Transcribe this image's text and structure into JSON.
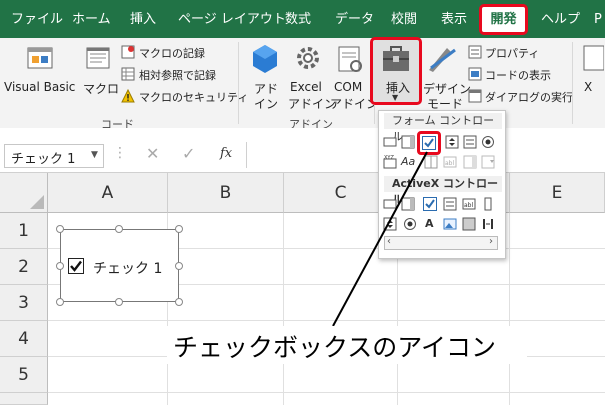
{
  "menu": {
    "tabs": [
      "ファイル",
      "ホーム",
      "挿入",
      "ページ レイアウト",
      "数式",
      "データ",
      "校閲",
      "表示"
    ],
    "active_tab": "開発",
    "after_tabs": [
      "ヘルプ",
      "P"
    ]
  },
  "ribbon": {
    "code": {
      "visual_basic": "Visual Basic",
      "macro": "マクロ",
      "record_macro": "マクロの記録",
      "relative_ref": "相対参照で記録",
      "macro_security": "マクロのセキュリティ",
      "group": "コード"
    },
    "addins": {
      "addin_l1": "アド",
      "addin_l2": "イン",
      "excel_l1": "Excel",
      "excel_l2": "アドイン",
      "com_l1": "COM",
      "com_l2": "アドイン",
      "group": "アドイン"
    },
    "controls": {
      "insert": "挿入",
      "design_l1": "デザイン",
      "design_l2": "モード",
      "properties": "プロパティ",
      "view_code": "コードの表示",
      "run_dialog": "ダイアログの実行"
    },
    "right_partial": "X"
  },
  "formula_bar": {
    "name_box": "チェック 1",
    "fx": "fx"
  },
  "sheet": {
    "columns": [
      "A",
      "B",
      "C",
      "D",
      "E"
    ],
    "rows": [
      "1",
      "2",
      "3",
      "4",
      "5"
    ],
    "checkbox_label": "チェック 1"
  },
  "insert_panel": {
    "form_controls_title": "フォーム コントロール",
    "activex_title": "ActiveX コントロール"
  },
  "annotation": {
    "text": "チェックボックスのアイコン"
  },
  "colors": {
    "excel_green": "#217346",
    "highlight_red": "#e8091e"
  }
}
